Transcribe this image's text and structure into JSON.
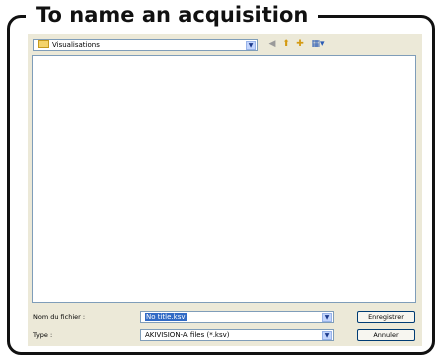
{
  "frame_title": "To name an acquisition",
  "location": {
    "folder_name": "Visualisations"
  },
  "toolbar": {
    "icons": [
      "dropdown-arrow",
      "back-icon",
      "up-folder-icon",
      "new-folder-icon",
      "view-menu-icon"
    ]
  },
  "filename": {
    "label": "Nom du fichier :",
    "value": "No title.ksv"
  },
  "filetype": {
    "label": "Type :",
    "value": "AKIVISION-A files (*.ksv)"
  },
  "buttons": {
    "save": "Enregistrer",
    "cancel": "Annuler"
  }
}
